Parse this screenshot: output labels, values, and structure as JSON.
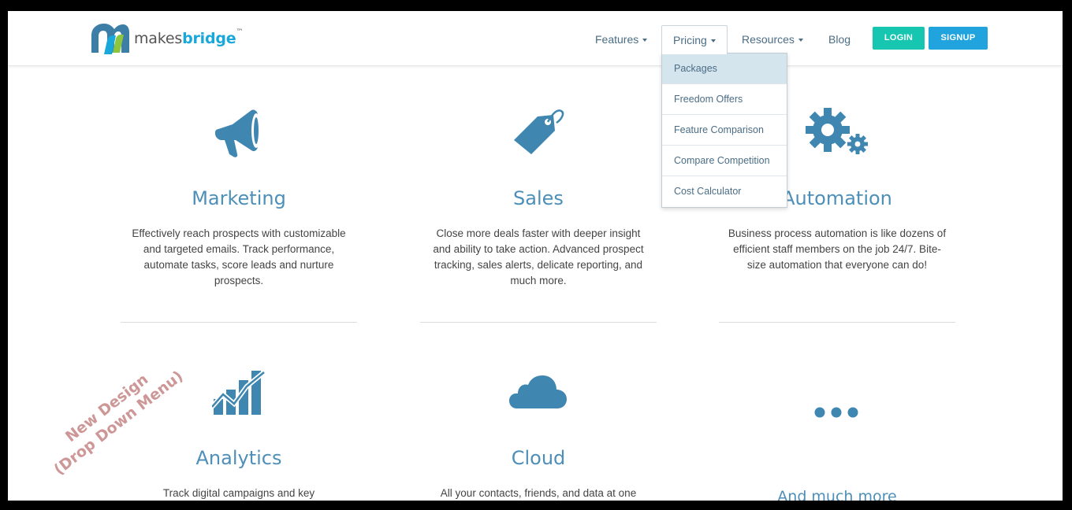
{
  "brand": {
    "name_part1": "makes",
    "name_part2": "bridge",
    "trademark": "™"
  },
  "nav": {
    "features": "Features",
    "pricing": "Pricing",
    "resources": "Resources",
    "blog": "Blog",
    "login": "LOGIN",
    "signup": "SIGNUP"
  },
  "pricing_dropdown": {
    "items": [
      {
        "label": "Packages"
      },
      {
        "label": "Freedom Offers"
      },
      {
        "label": "Feature Comparison"
      },
      {
        "label": "Compare Competition"
      },
      {
        "label": "Cost Calculator"
      }
    ],
    "active_item": "Packages"
  },
  "features": {
    "marketing": {
      "title": "Marketing",
      "icon": "megaphone-icon",
      "text": "Effectively reach prospects with customizable and targeted emails. Track performance, automate tasks, score leads and nurture prospects."
    },
    "sales": {
      "title": "Sales",
      "icon": "price-tag-icon",
      "text": "Close more deals faster with deeper insight and ability to take action. Advanced prospect tracking, sales alerts, delicate reporting, and much more."
    },
    "automation": {
      "title": "Automation",
      "icon": "gears-icon",
      "text": "Business process automation is like dozens of efficient staff members on the job 24/7. Bite-size automation that everyone can do!"
    },
    "analytics": {
      "title": "Analytics",
      "icon": "bar-chart-trend-icon",
      "text": "Track digital campaigns and key"
    },
    "cloud": {
      "title": "Cloud",
      "icon": "cloud-icon",
      "text": "All your contacts, friends, and data at one"
    },
    "more": {
      "title": "And much more",
      "icon": "ellipsis-icon"
    }
  },
  "annotation": {
    "line1": "New Design",
    "line2": "(Drop Down Menu)"
  },
  "colors": {
    "accent_blue": "#4d8fb8",
    "icon_blue": "#3f86b1",
    "login_teal": "#16c6b0",
    "signup_blue": "#21a4dd",
    "dropdown_active": "#d5e5ee",
    "annotation_red": "#c98c8c"
  }
}
